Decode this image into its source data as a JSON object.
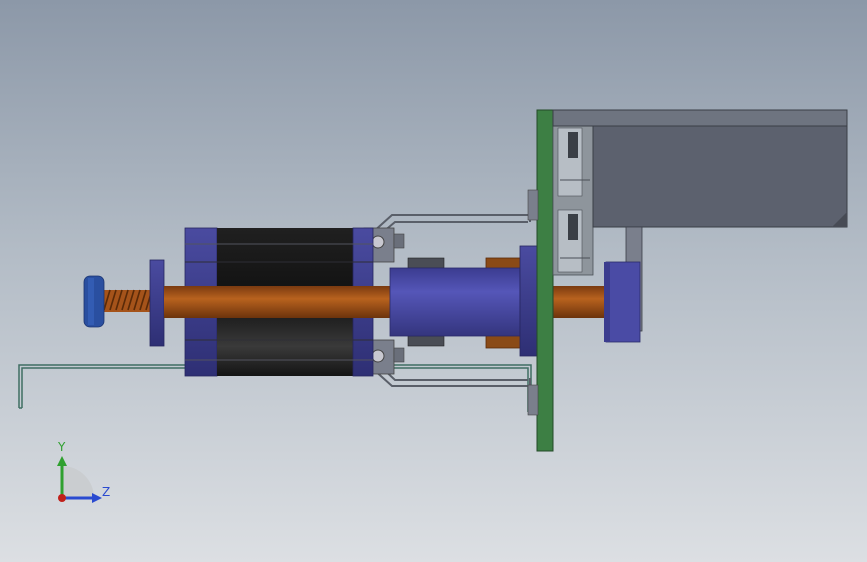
{
  "viewport": {
    "background_top": "#8c98a8",
    "background_bottom": "#dcdfe3"
  },
  "model": {
    "colors": {
      "bracket_green": "#3d7f44",
      "housing_gray": "#5c616e",
      "housing_light": "#6e7480",
      "motor_black": "#141414",
      "motor_end_blue": "#3c3d8a",
      "cylinder_blue": "#4a4ba5",
      "shaft_copper": "#9c4c14",
      "knob_blue": "#2a4fa0",
      "guide_rail": "#9aa1a8",
      "wire_green": "#3f6e62"
    },
    "parts": [
      "mounting-plate",
      "motor-housing",
      "linear-guide-rails",
      "stepper-motor",
      "lead-screw",
      "actuator-cylinder",
      "adjustment-knob",
      "support-brackets",
      "guide-rod"
    ]
  },
  "triad": {
    "y_label": "Y",
    "z_label": "Z",
    "y_color": "#2fa02f",
    "z_color": "#2a4ad0",
    "x_color": "#c0201a"
  }
}
